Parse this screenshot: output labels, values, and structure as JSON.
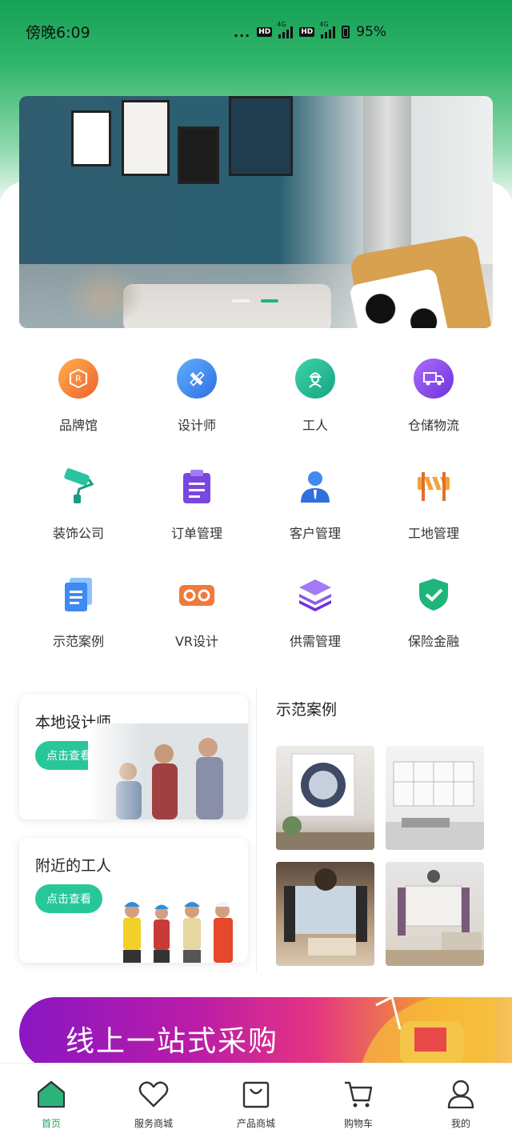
{
  "status_bar": {
    "time": "傍晚6:09",
    "dots": "...",
    "hd1": "HD",
    "net1": "4G",
    "hd2": "HD",
    "net2": "4G",
    "battery": "95%"
  },
  "banner": {
    "dots": 2,
    "active_dot": 1
  },
  "grid": {
    "items": [
      {
        "label": "品牌馆",
        "icon": "brand-badge-icon",
        "color": "#f07a3a"
      },
      {
        "label": "设计师",
        "icon": "ruler-pencil-icon",
        "color": "#3b82e8"
      },
      {
        "label": "工人",
        "icon": "worker-icon",
        "color": "#22b38e"
      },
      {
        "label": "仓储物流",
        "icon": "truck-icon",
        "color": "#8b46e6"
      },
      {
        "label": "装饰公司",
        "icon": "paint-roller-icon",
        "color": "#20b49a"
      },
      {
        "label": "订单管理",
        "icon": "clipboard-icon",
        "color": "#7a46e0"
      },
      {
        "label": "客户管理",
        "icon": "customer-icon",
        "color": "#2f7fe6"
      },
      {
        "label": "工地管理",
        "icon": "barrier-icon",
        "color": "#f08a2a"
      },
      {
        "label": "示范案例",
        "icon": "documents-icon",
        "color": "#3f8af0"
      },
      {
        "label": "VR设计",
        "icon": "vr-goggles-icon",
        "color": "#f07a3a"
      },
      {
        "label": "供需管理",
        "icon": "layers-icon",
        "color": "#7a46e0"
      },
      {
        "label": "保险金融",
        "icon": "shield-check-icon",
        "color": "#1fb57a"
      }
    ]
  },
  "cards": {
    "designer": {
      "title": "本地设计师",
      "button": "点击查看"
    },
    "workers": {
      "title": "附近的工人",
      "button": "点击查看"
    }
  },
  "cases": {
    "title": "示范案例"
  },
  "promo": {
    "title": "线上一站式采购"
  },
  "tabbar": {
    "items": [
      {
        "label": "首页",
        "icon": "home-icon",
        "active": true
      },
      {
        "label": "服务商城",
        "icon": "heart-icon",
        "active": false
      },
      {
        "label": "产品商城",
        "icon": "bag-icon",
        "active": false
      },
      {
        "label": "购物车",
        "icon": "cart-icon",
        "active": false
      },
      {
        "label": "我的",
        "icon": "user-icon",
        "active": false
      }
    ]
  },
  "colors": {
    "primary": "#20a55e",
    "button": "#27c79a"
  }
}
